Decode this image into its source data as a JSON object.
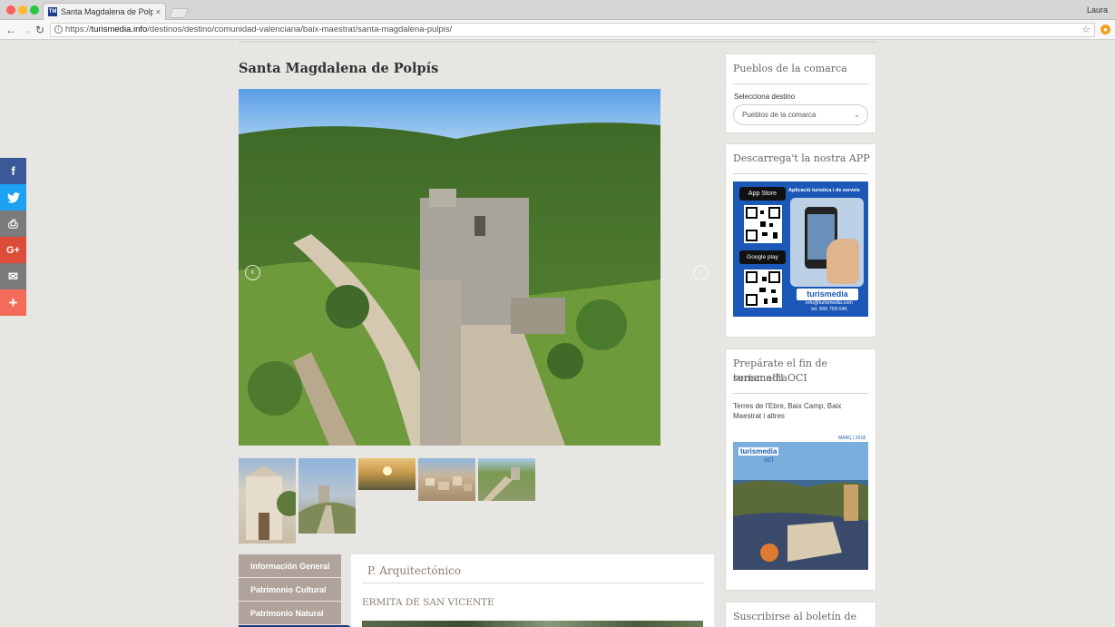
{
  "browser": {
    "tab_title": "Santa Magdalena de Polpís - T",
    "tab_favicon": "TM",
    "tab_close": "×",
    "user": "Laura",
    "url_scheme": "https://",
    "url_domain": "turismedia.info",
    "url_path": "/destinos/destino/comunidad-valenciana/baix-maestrat/santa-magdalena-pulpis/",
    "back_icon": "←",
    "forward_icon": "→",
    "reload_icon": "↻",
    "star_icon": "☆",
    "info_icon": "i",
    "ext_icon": "●"
  },
  "page": {
    "title": "Santa Magdalena de Polpís"
  },
  "carousel": {
    "prev": "‹",
    "next": "›",
    "thumbnails": [
      "thumb-church",
      "thumb-castle",
      "thumb-sunrise",
      "thumb-village",
      "thumb-ruins"
    ]
  },
  "social": [
    {
      "name": "facebook",
      "glyph": "f",
      "color": "#3b5998"
    },
    {
      "name": "twitter",
      "glyph": "t",
      "color": "#1da1f2"
    },
    {
      "name": "print",
      "glyph": "⎙",
      "color": "#7b7b7b"
    },
    {
      "name": "google-plus",
      "glyph": "G+",
      "color": "#dd4b39"
    },
    {
      "name": "email",
      "glyph": "✉",
      "color": "#7b7b7b"
    },
    {
      "name": "more",
      "glyph": "+",
      "color": "#f36c5a"
    }
  ],
  "tabs": [
    {
      "label": "Información General"
    },
    {
      "label": "Patrimonio Cultural"
    },
    {
      "label": "Patrimonio Natural"
    },
    {
      "label": ""
    }
  ],
  "content": {
    "heading": "P. Arquitectónico",
    "subheading": "ERMITA DE SAN VICENTE"
  },
  "sidebar": {
    "pueblos": {
      "title": "Pueblos de la comarca",
      "label": "Selecciona destino",
      "select_value": "Pueblos de la comarca",
      "chevron": "⌄"
    },
    "app": {
      "title": "Descarrega't la nostra APP",
      "banner_appstore": "App Store",
      "banner_google": "Google play",
      "banner_heading": "Aplicació turística i de serveis",
      "banner_brand": "turismedia",
      "banner_email": "info@turismedia.com",
      "banner_phone": "tel. 665 759 046"
    },
    "oci": {
      "title_line1": "Prepárate el fin de semana!!!",
      "title_line2": "turismediaOCI",
      "text": "Terres de l'Ebre, Baix Camp, Baix Maestrat i altres",
      "cover_month": "MARÇ | 2018",
      "cover_brand": "turismedia",
      "cover_sub": "oci"
    },
    "newsletter": {
      "title": "Suscribirse al boletín de"
    }
  },
  "colors": {
    "page_bg": "#e8e6e3",
    "tab_bg": "#b0a39b",
    "tab_active": "#1a3a78",
    "app_banner": "#1b58b8"
  }
}
